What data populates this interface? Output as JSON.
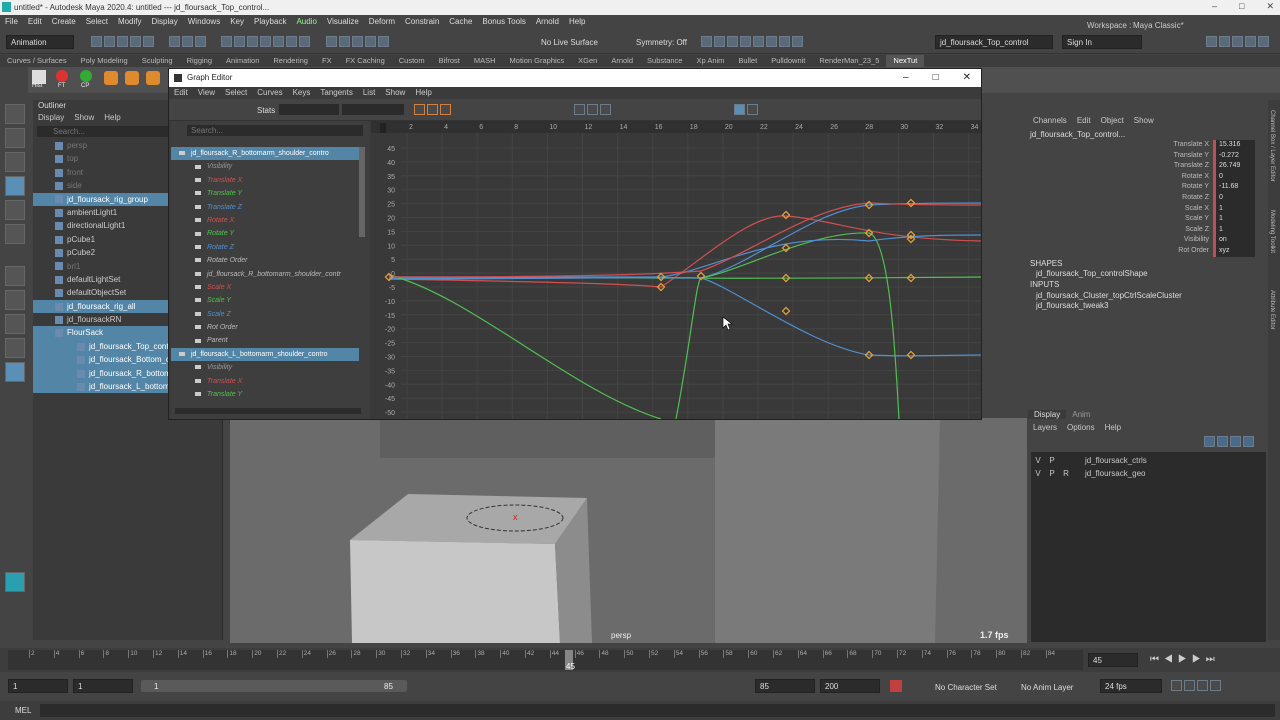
{
  "app": {
    "title": "untitled* - Autodesk Maya 2020.4: untitled   ---   jd_floursack_Top_control..."
  },
  "menubar": [
    "File",
    "Edit",
    "Create",
    "Select",
    "Modify",
    "Display",
    "Windows",
    "Key",
    "Playback",
    "Audio",
    "Visualize",
    "Deform",
    "Constrain",
    "Cache",
    "Bonus Tools",
    "Arnold",
    "Help"
  ],
  "status": {
    "menuset": "Animation",
    "no_live": "No Live Surface",
    "symmetry": "Symmetry: Off",
    "object_field": "jd_floursack_Top_control",
    "signin": "Sign In",
    "workspace_label": "Workspace :",
    "workspace": "Maya Classic*"
  },
  "shelf_tabs": [
    "Curves / Surfaces",
    "Poly Modeling",
    "Sculpting",
    "Rigging",
    "Animation",
    "Rendering",
    "FX",
    "FX Caching",
    "Custom",
    "Bifrost",
    "MASH",
    "Motion Graphics",
    "XGen",
    "Arnold",
    "Substance",
    "Xp Anim",
    "Bullet",
    "Pulldownit",
    "RenderMan_23_5",
    "NexTut"
  ],
  "shelf_labels": [
    "Hist",
    "FT",
    "CP"
  ],
  "outliner": {
    "title": "Outliner",
    "menu": [
      "Display",
      "Show",
      "Help"
    ],
    "search": "Search...",
    "items": [
      {
        "label": "persp",
        "indent": 1,
        "state": "dim"
      },
      {
        "label": "top",
        "indent": 1,
        "state": "dim"
      },
      {
        "label": "front",
        "indent": 1,
        "state": "dim"
      },
      {
        "label": "side",
        "indent": 1,
        "state": "dim"
      },
      {
        "label": "jd_floursack_rig_group",
        "indent": 1,
        "state": "sel"
      },
      {
        "label": "ambientLight1",
        "indent": 1,
        "state": ""
      },
      {
        "label": "directionalLight1",
        "indent": 1,
        "state": ""
      },
      {
        "label": "pCube1",
        "indent": 1,
        "state": ""
      },
      {
        "label": "pCube2",
        "indent": 1,
        "state": ""
      },
      {
        "label": "brl1",
        "indent": 1,
        "state": "dim"
      },
      {
        "label": "defaultLightSet",
        "indent": 1,
        "state": ""
      },
      {
        "label": "defaultObjectSet",
        "indent": 1,
        "state": ""
      },
      {
        "label": "jd_floursack_rig_all",
        "indent": 1,
        "state": "sel"
      },
      {
        "label": "jd_floursackRN",
        "indent": 1,
        "state": ""
      },
      {
        "label": "FlourSack",
        "indent": 1,
        "state": "sel"
      },
      {
        "label": "jd_floursack_Top_control",
        "indent": 2,
        "state": "sel"
      },
      {
        "label": "jd_floursack_Bottom_cont",
        "indent": 2,
        "state": "sel"
      },
      {
        "label": "jd_floursack_R_bottomarm",
        "indent": 2,
        "state": "sel"
      },
      {
        "label": "jd_floursack_L_bottomarm",
        "indent": 2,
        "state": "sel"
      }
    ]
  },
  "graph_editor": {
    "title": "Graph Editor",
    "menu": [
      "Edit",
      "View",
      "Select",
      "Curves",
      "Keys",
      "Tangents",
      "List",
      "Show",
      "Help"
    ],
    "stats": "Stats",
    "search": "Search...",
    "outline": [
      {
        "label": "jd_floursack_R_bottomarm_shoulder_contro",
        "color": "#ffffff",
        "sel": true
      },
      {
        "label": "Visibility",
        "color": "#999999"
      },
      {
        "label": "Translate X",
        "color": "#d05050"
      },
      {
        "label": "Translate Y",
        "color": "#50c050"
      },
      {
        "label": "Translate Z",
        "color": "#5090d0"
      },
      {
        "label": "Rotate X",
        "color": "#d05050"
      },
      {
        "label": "Rotate Y",
        "color": "#50c050"
      },
      {
        "label": "Rotate Z",
        "color": "#5090d0"
      },
      {
        "label": "Rotate Order",
        "color": "#bbbbbb"
      },
      {
        "label": "jd_floursack_R_bottomarm_shoulder_contr",
        "color": "#bbbbbb"
      },
      {
        "label": "Scale X",
        "color": "#d05050"
      },
      {
        "label": "Scale Y",
        "color": "#50c050"
      },
      {
        "label": "Scale Z",
        "color": "#5090d0"
      },
      {
        "label": "Rot Order",
        "color": "#bbbbbb"
      },
      {
        "label": "Parent",
        "color": "#bbbbbb"
      },
      {
        "label": "jd_floursack_L_bottomarm_shoulder_contro",
        "color": "#ffffff",
        "sel": true
      },
      {
        "label": "Visibility",
        "color": "#999999"
      },
      {
        "label": "Translate X",
        "color": "#d05050"
      },
      {
        "label": "Translate Y",
        "color": "#50c050"
      }
    ],
    "frame_ticks": [
      "2",
      "4",
      "6",
      "8",
      "10",
      "12",
      "14",
      "16",
      "18",
      "20",
      "22",
      "24",
      "26",
      "28",
      "30",
      "32",
      "34"
    ],
    "frame_marker": "1",
    "value_ticks": [
      "45",
      "40",
      "35",
      "30",
      "25",
      "20",
      "15",
      "10",
      "5",
      "0",
      "-5",
      "-10",
      "-15",
      "-20",
      "-25",
      "-30",
      "-35",
      "-40",
      "-45",
      "-50"
    ]
  },
  "viewport": {
    "camera": "persp",
    "fps": "1.7 fps"
  },
  "channelbox": {
    "menu": [
      "Channels",
      "Edit",
      "Object",
      "Show"
    ],
    "object": "jd_floursack_Top_control...",
    "channels": [
      {
        "name": "Translate X",
        "value": "15.316"
      },
      {
        "name": "Translate Y",
        "value": "-0.272"
      },
      {
        "name": "Translate Z",
        "value": "26.749"
      },
      {
        "name": "Rotate X",
        "value": "0"
      },
      {
        "name": "Rotate Y",
        "value": "-11.68"
      },
      {
        "name": "Rotate Z",
        "value": "0"
      },
      {
        "name": "Scale X",
        "value": "1"
      },
      {
        "name": "Scale Y",
        "value": "1"
      },
      {
        "name": "Scale Z",
        "value": "1"
      },
      {
        "name": "Visibility",
        "value": "on"
      },
      {
        "name": "Rot Order",
        "value": "xyz"
      }
    ],
    "shapes_label": "SHAPES",
    "shape": "jd_floursack_Top_controlShape",
    "inputs_label": "INPUTS",
    "inputs": [
      "jd_floursack_Cluster_topCtrlScaleCluster",
      "jd_floursack_tweak3"
    ],
    "side_tabs": [
      "Channel Box / Layer Editor",
      "Modeling Toolkit",
      "Attribute Editor"
    ]
  },
  "layers": {
    "tabs": [
      "Display",
      "Anim"
    ],
    "menu": [
      "Layers",
      "Options",
      "Help"
    ],
    "rows": [
      {
        "v": "V",
        "p": "P",
        "r": "",
        "name": "jd_floursack_ctrls"
      },
      {
        "v": "V",
        "p": "P",
        "r": "R",
        "name": "jd_floursack_geo"
      }
    ]
  },
  "time": {
    "ticks": [
      "2",
      "4",
      "6",
      "8",
      "10",
      "12",
      "14",
      "16",
      "18",
      "20",
      "22",
      "24",
      "26",
      "28",
      "30",
      "32",
      "34",
      "36",
      "38",
      "40",
      "42",
      "44",
      "46",
      "48",
      "50",
      "52",
      "54",
      "56",
      "58",
      "60",
      "62",
      "64",
      "66",
      "68",
      "70",
      "72",
      "74",
      "76",
      "78",
      "80",
      "82",
      "84"
    ],
    "current": "45",
    "current_field": "45"
  },
  "range": {
    "start": "1",
    "start2": "1",
    "slider_start": "1",
    "slider_end": "85",
    "end": "85",
    "end2": "200",
    "character_set": "No Character Set",
    "anim_layer": "No Anim Layer",
    "fps": "24 fps"
  },
  "cmd": {
    "label": "MEL"
  }
}
